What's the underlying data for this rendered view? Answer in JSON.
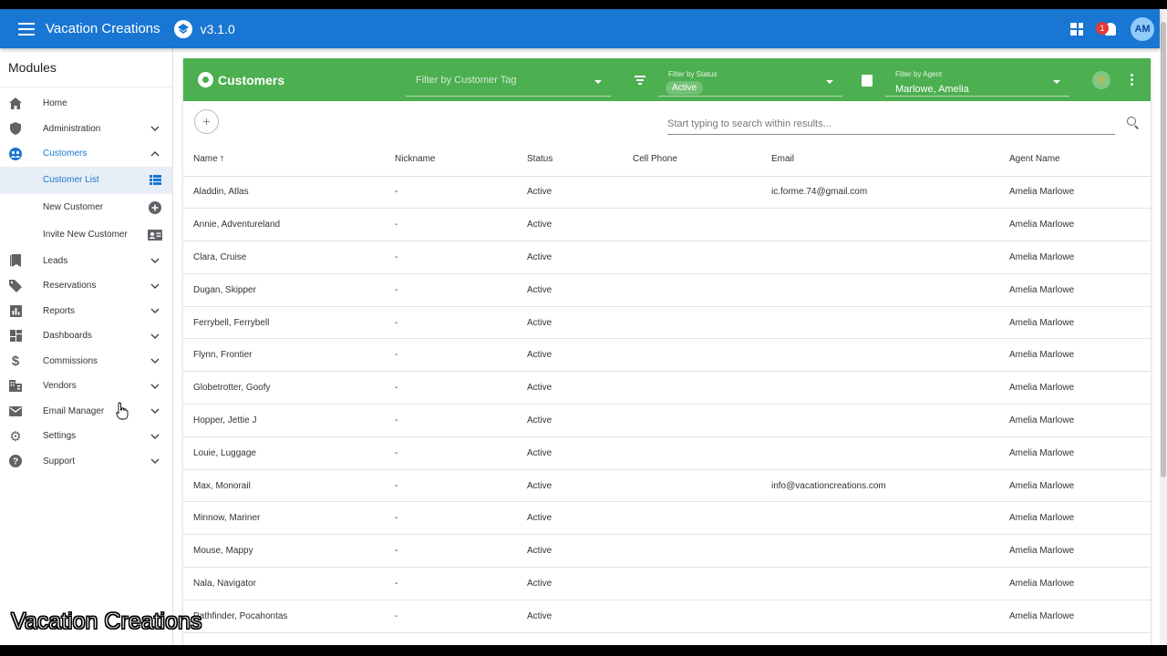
{
  "appbar": {
    "title": "Vacation Creations",
    "version": "v3.1.0",
    "notification_count": "1",
    "avatar_initials": "AM",
    "color": "#1976d2"
  },
  "sidebar": {
    "heading": "Modules",
    "items": [
      {
        "label": "Home",
        "icon": "home-icon",
        "chevron": "none"
      },
      {
        "label": "Administration",
        "icon": "shield-icon",
        "chevron": "down"
      },
      {
        "label": "Customers",
        "icon": "customers-icon",
        "chevron": "up",
        "active": true
      },
      {
        "label": "Leads",
        "icon": "bookmark-icon",
        "chevron": "down"
      },
      {
        "label": "Reservations",
        "icon": "tag-icon",
        "chevron": "down"
      },
      {
        "label": "Reports",
        "icon": "bar-chart-icon",
        "chevron": "down"
      },
      {
        "label": "Dashboards",
        "icon": "dashboard-icon",
        "chevron": "down"
      },
      {
        "label": "Commissions",
        "icon": "dollar-icon",
        "chevron": "down"
      },
      {
        "label": "Vendors",
        "icon": "building-icon",
        "chevron": "down"
      },
      {
        "label": "Email Manager",
        "icon": "mail-icon",
        "chevron": "down"
      },
      {
        "label": "Settings",
        "icon": "gear-icon",
        "chevron": "down"
      },
      {
        "label": "Support",
        "icon": "help-icon",
        "chevron": "down"
      }
    ],
    "sub_items": [
      {
        "label": "Customer List",
        "icon": "list-icon",
        "selected": true
      },
      {
        "label": "New Customer",
        "icon": "add-circle-icon"
      },
      {
        "label": "Invite New Customer",
        "icon": "contact-card-icon"
      }
    ]
  },
  "card": {
    "title": "Customers",
    "header_color": "#4caf50",
    "tag_filter_placeholder": "Filter by Customer Tag",
    "status_filter_label": "Filter by Status",
    "status_filter_value": "Active",
    "agent_filter_label": "Filter by Agent",
    "agent_filter_value": "Marlowe, Amelia",
    "search_placeholder": "Start typing to search within results..."
  },
  "table": {
    "columns": [
      "Name",
      "Nickname",
      "Status",
      "Cell Phone",
      "Email",
      "Agent Name"
    ],
    "rows": [
      [
        "Aladdin, Atlas",
        "-",
        "Active",
        "",
        "ic.forme.74@gmail.com",
        "Amelia Marlowe"
      ],
      [
        "Annie, Adventureland",
        "-",
        "Active",
        "",
        "",
        "Amelia Marlowe"
      ],
      [
        "Clara, Cruise",
        "-",
        "Active",
        "",
        "",
        "Amelia Marlowe"
      ],
      [
        "Dugan, Skipper",
        "-",
        "Active",
        "",
        "",
        "Amelia Marlowe"
      ],
      [
        "Ferrybell, Ferrybell",
        "-",
        "Active",
        "",
        "",
        "Amelia Marlowe"
      ],
      [
        "Flynn, Frontier",
        "-",
        "Active",
        "",
        "",
        "Amelia Marlowe"
      ],
      [
        "Globetrotter, Goofy",
        "-",
        "Active",
        "",
        "",
        "Amelia Marlowe"
      ],
      [
        "Hopper, Jettie J",
        "-",
        "Active",
        "",
        "",
        "Amelia Marlowe"
      ],
      [
        "Louie, Luggage",
        "-",
        "Active",
        "",
        "",
        "Amelia Marlowe"
      ],
      [
        "Max, Monorail",
        "-",
        "Active",
        "",
        "info@vacationcreations.com",
        "Amelia Marlowe"
      ],
      [
        "Minnow, Mariner",
        "-",
        "Active",
        "",
        "",
        "Amelia Marlowe"
      ],
      [
        "Mouse, Mappy",
        "-",
        "Active",
        "",
        "",
        "Amelia Marlowe"
      ],
      [
        "Nala, Navigator",
        "-",
        "Active",
        "",
        "",
        "Amelia Marlowe"
      ],
      [
        "Pathfinder, Pocahontas",
        "-",
        "Active",
        "",
        "",
        "Amelia Marlowe"
      ]
    ]
  },
  "watermark": "Vacation Creations"
}
